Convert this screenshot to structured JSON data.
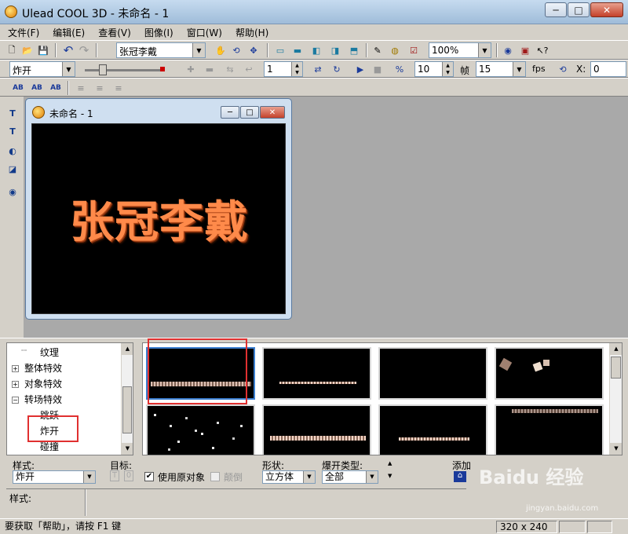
{
  "window": {
    "title": "Ulead COOL 3D - 未命名 - 1"
  },
  "menu": [
    "文件(F)",
    "编辑(E)",
    "查看(V)",
    "图像(I)",
    "窗口(W)",
    "帮助(H)"
  ],
  "toolbar1": {
    "object_combo": "张冠李戴",
    "zoom_combo": "100%"
  },
  "toolbar2": {
    "effect_combo": "炸开",
    "frame_value": "1",
    "frames_value": "10",
    "frames_label": "帧",
    "fps_value": "15",
    "fps_label": "fps",
    "x_label": "X:",
    "x_value": "0"
  },
  "toolbar3": {
    "ab1": "AB",
    "ab2": "AB",
    "ab3": "AB"
  },
  "document": {
    "title": "未命名 - 1",
    "text": "张冠李戴"
  },
  "tree": {
    "items": [
      "纹理",
      "整体特效",
      "对象特效",
      "转场特效",
      "跳跃",
      "炸开",
      "碰撞"
    ]
  },
  "options": {
    "style_label": "样式:",
    "style_value": "炸开",
    "target_label": "目标:",
    "target_t": "T",
    "target_o": "0",
    "use_original_label": "使用原对象",
    "use_original_checked": "✔",
    "reverse_label": "颠倒",
    "shape_label": "形状:",
    "shape_value": "立方体",
    "explode_label": "爆开类型:",
    "explode_value": "全部",
    "add_label": "添加"
  },
  "style_panel_label": "样式:",
  "status": {
    "help": "要获取「帮助」，请按 F1 键",
    "size": "320 x 240"
  },
  "watermark": {
    "brand": "Baidu 经验",
    "url": "jingyan.baidu.com"
  }
}
